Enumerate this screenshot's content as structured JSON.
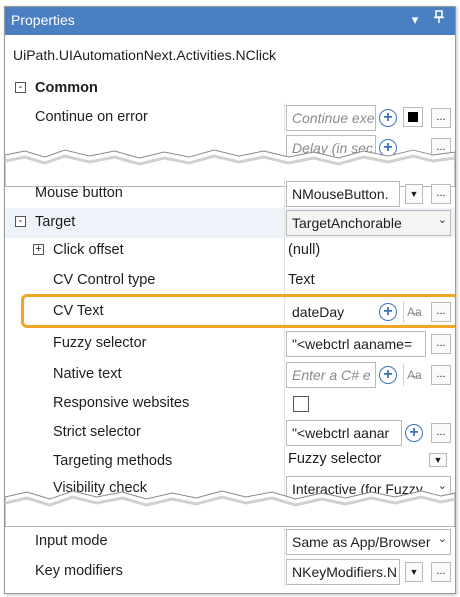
{
  "panel": {
    "title": "Properties",
    "type_name": "UiPath.UIAutomationNext.Activities.NClick"
  },
  "colors": {
    "titlebar": "#4a7fc1",
    "highlight": "#f0a428"
  },
  "rows": {
    "common": {
      "label": "Common",
      "expander": "-"
    },
    "continue_on_error": {
      "label": "Continue on error",
      "placeholder": "Continue exe"
    },
    "delay_partial": {
      "placeholder": "Delay (in sec"
    },
    "mouse_button": {
      "label": "Mouse button",
      "value": "NMouseButton."
    },
    "target": {
      "label": "Target",
      "expander": "-",
      "value": "TargetAnchorable"
    },
    "click_offset": {
      "label": "Click offset",
      "expander": "+",
      "value": "(null)"
    },
    "cv_control_type": {
      "label": "CV Control type",
      "value": "Text"
    },
    "cv_text": {
      "label": "CV Text",
      "value": "dateDay"
    },
    "fuzzy_selector": {
      "label": "Fuzzy selector",
      "value": "\"<webctrl aaname="
    },
    "native_text": {
      "label": "Native text",
      "placeholder": "Enter a C# e"
    },
    "responsive_websites": {
      "label": "Responsive websites"
    },
    "strict_selector": {
      "label": "Strict selector",
      "value": "\"<webctrl aanar"
    },
    "targeting_methods": {
      "label": "Targeting methods",
      "value": "Fuzzy selector"
    },
    "visibility_check": {
      "label": "Visibility check",
      "value": "Interactive (for Fuzzy"
    },
    "input_mode": {
      "label": "Input mode",
      "value": "Same as App/Browser"
    },
    "key_modifiers": {
      "label": "Key modifiers",
      "value": "NKeyModifiers.N"
    }
  },
  "icons": {
    "add": "plus-circle-icon",
    "ellipsis": "...",
    "dropdown": "chevron-down-icon",
    "aa": "text-mode-icon"
  }
}
